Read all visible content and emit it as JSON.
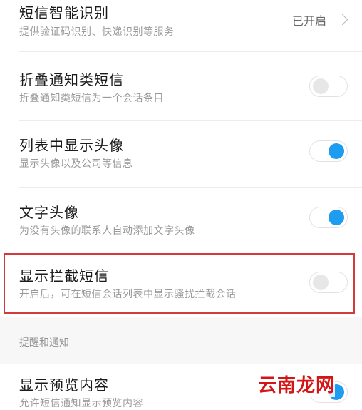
{
  "settings": [
    {
      "title": "短信智能识别",
      "subtitle": "提供验证码识别、快递识别等服务",
      "control": "chevron",
      "value": "已开启"
    },
    {
      "title": "折叠通知类短信",
      "subtitle": "折叠通知类短信为一个会话条目",
      "control": "toggle",
      "on": false
    },
    {
      "title": "列表中显示头像",
      "subtitle": "显示头像以及公司等信息",
      "control": "toggle",
      "on": true
    },
    {
      "title": "文字头像",
      "subtitle": "为没有头像的联系人自动添加文字头像",
      "control": "toggle",
      "on": true
    },
    {
      "title": "显示拦截短信",
      "subtitle": "开启后，可在短信会话列表中显示骚扰拦截会话",
      "control": "toggle",
      "on": false
    }
  ],
  "section": {
    "header": "提醒和通知"
  },
  "preview": {
    "title": "显示预览内容",
    "subtitle": "允许短信通知显示预览内容",
    "control": "toggle",
    "on": true
  },
  "watermark": "云南龙网",
  "colors": {
    "accent": "#1e9cf0",
    "highlight_border": "#d33a3a",
    "watermark": "#d41515"
  }
}
